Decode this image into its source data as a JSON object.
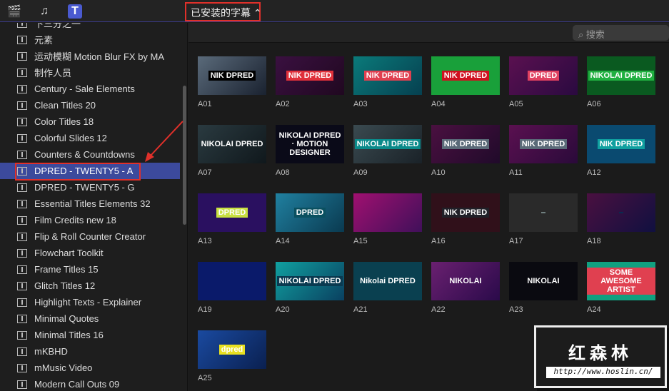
{
  "toolbar": {
    "icons": [
      "clapper-icon",
      "music-icon",
      "titles-icon"
    ],
    "dropdown_label": "已安装的字幕 ⌃"
  },
  "sidebar": {
    "items": [
      "下三分之一",
      "元素",
      "运动模糊 Motion Blur FX by MA",
      "制作人员",
      "Century - Sale Elements",
      "Clean Titles 20",
      "Color Titles 18",
      "Colorful Slides 12",
      "Counters & Countdowns",
      "DPRED - TWENTY5 - A",
      "DPRED - TWENTY5 - G",
      "Essential Titles Elements 32",
      "Film Credits new 18",
      "Flip & Roll Counter Creator",
      "Flowchart Toolkit",
      "Frame Titles 15",
      "Glitch Titles 12",
      "Highlight Texts - Explainer",
      "Minimal Quotes",
      "Minimal Titles 16",
      "mKBHD",
      "mMusic Video",
      "Modern Call Outs 09"
    ],
    "selected_index": 9
  },
  "search": {
    "placeholder": "搜索"
  },
  "thumbnails": [
    {
      "label": "A01",
      "text": "NIK DPRED",
      "bg": "linear-gradient(135deg,#5a6a7a,#1a2230)",
      "tbg": "#000"
    },
    {
      "label": "A02",
      "text": "NIK DPRED",
      "bg": "linear-gradient(135deg,#3a1040,#200820)",
      "tbg": "#e0303a"
    },
    {
      "label": "A03",
      "text": "NIK DPRED",
      "bg": "linear-gradient(135deg,#0a7a7a,#064050)",
      "tbg": "#e04050"
    },
    {
      "label": "A04",
      "text": "NIK DPRED",
      "bg": "#19a03a",
      "tbg": "#d01020"
    },
    {
      "label": "A05",
      "text": "DPRED",
      "bg": "linear-gradient(135deg,#5a1050,#2a0a40)",
      "tbg": "#e04060"
    },
    {
      "label": "A06",
      "text": "NIKOLAI DPRED",
      "bg": "#0a5a20",
      "tbg": "#20b040"
    },
    {
      "label": "A07",
      "text": "NIKOLAI DPRED",
      "bg": "linear-gradient(135deg,#2a3a40,#10181c)",
      "tbg": "transparent"
    },
    {
      "label": "A08",
      "text": "NIKOLAI DPRED · MOTION DESIGNER",
      "bg": "#0a0a18",
      "tbg": "transparent"
    },
    {
      "label": "A09",
      "text": "NIKOLAI DPRED",
      "bg": "linear-gradient(135deg,#3a4a50,#1a2228)",
      "tbg": "#0a8a8a"
    },
    {
      "label": "A10",
      "text": "NIK DPRED",
      "bg": "linear-gradient(135deg,#4a1040,#200a2a)",
      "tbg": "#5a6a78"
    },
    {
      "label": "A11",
      "text": "NIK DPRED",
      "bg": "linear-gradient(135deg,#5a1050,#2a0a3a)",
      "tbg": "#5a6a78"
    },
    {
      "label": "A12",
      "text": "NIK DPRED",
      "bg": "#0a4a70",
      "tbg": "#10a0a0"
    },
    {
      "label": "A13",
      "text": "DPRED",
      "bg": "#2a1060",
      "tbg": "#c8e040"
    },
    {
      "label": "A14",
      "text": "DPRED",
      "bg": "linear-gradient(135deg,#2080a0,#0a3a50)",
      "tbg": "#0a5060"
    },
    {
      "label": "A15",
      "text": "",
      "bg": "linear-gradient(135deg,#a01070,#40105a)",
      "tbg": "transparent"
    },
    {
      "label": "A16",
      "text": "NIK DPRED",
      "bg": "#30101a",
      "tbg": "#202028"
    },
    {
      "label": "A17",
      "text": "",
      "bg": "#2a2a2a",
      "tbg": "#708080"
    },
    {
      "label": "A18",
      "text": "",
      "bg": "linear-gradient(135deg,#4a1040,#101040)",
      "tbg": "#0a2a50"
    },
    {
      "label": "A19",
      "text": "",
      "bg": "#0a1a6a",
      "tbg": "transparent"
    },
    {
      "label": "A20",
      "text": "NIKOLAI DPRED",
      "bg": "linear-gradient(135deg,#10a0a0,#0a4060)",
      "tbg": "#0a3a50"
    },
    {
      "label": "A21",
      "text": "Nikolai DPRED",
      "bg": "#0a4050",
      "tbg": "transparent"
    },
    {
      "label": "A22",
      "text": "NIKOLAI",
      "bg": "linear-gradient(135deg,#6a2070,#2a0a4a)",
      "tbg": "transparent"
    },
    {
      "label": "A23",
      "text": "NIKOLAI",
      "bg": "#0a0a10",
      "tbg": "transparent"
    },
    {
      "label": "A24",
      "text": "SOME AWESOME ARTIST",
      "bg": "#10a080",
      "tbg": "#e04050"
    },
    {
      "label": "A25",
      "text": "dpred",
      "bg": "linear-gradient(135deg,#1a4aa0,#0a2050)",
      "tbg": "#e8e020"
    }
  ],
  "watermark": {
    "name": "红森林",
    "url": "http://www.hoslin.cn/"
  }
}
